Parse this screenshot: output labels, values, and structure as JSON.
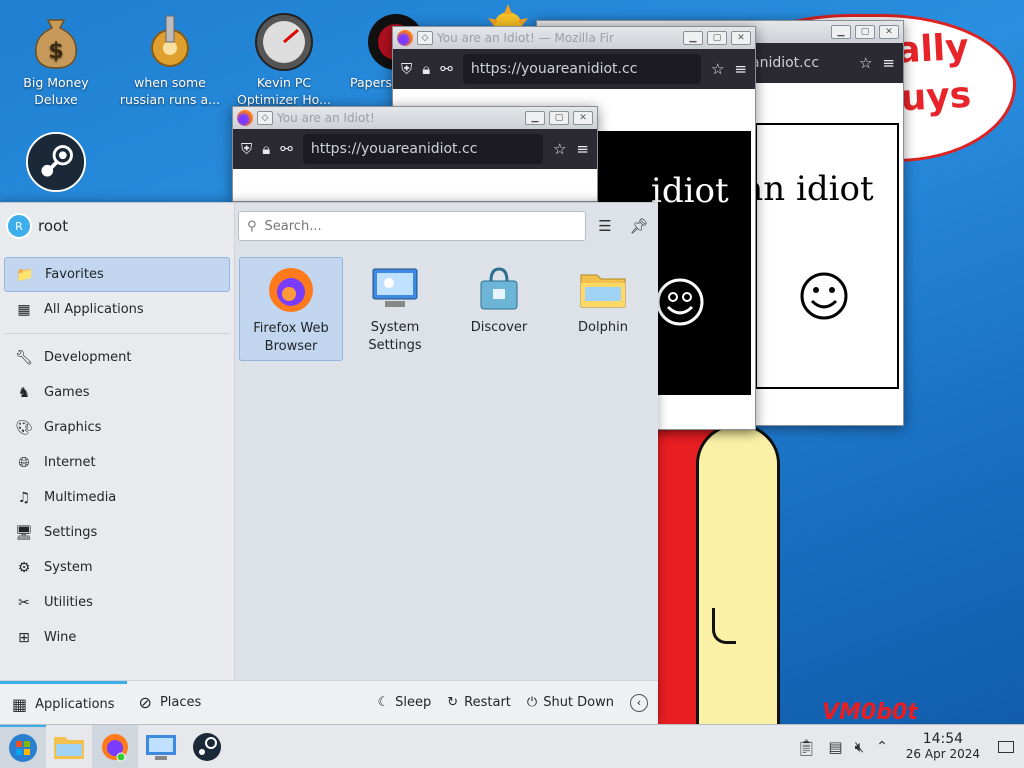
{
  "desktop": {
    "icons": [
      {
        "label": "Big Money\nDeluxe",
        "name": "big-money-deluxe"
      },
      {
        "label": "when some\nrussian runs a...",
        "name": "russian-runs"
      },
      {
        "label": "Kevin PC\nOptimizer Ho...",
        "name": "kevin-pc-optimizer"
      },
      {
        "label": "Papers",
        "name": "papers"
      }
    ],
    "background_text": "...is totally\nguys",
    "signature": "VM0b0t"
  },
  "windows": [
    {
      "title": "You are an Idiot! — Mozilla Fir",
      "url": "https://youareanidiot.cc",
      "content_text": "an idiot"
    },
    {
      "title": "",
      "url": "https://youareanidiot.cc",
      "content_text": "idiot"
    },
    {
      "title": "You are an Idiot!",
      "url": "https://youareanidiot.cc"
    }
  ],
  "menu": {
    "user": "root",
    "avatar_letter": "R",
    "search_placeholder": "Search...",
    "categories": [
      {
        "label": "Favorites",
        "active": true
      },
      {
        "label": "All Applications"
      },
      {
        "label": "Development"
      },
      {
        "label": "Games"
      },
      {
        "label": "Graphics"
      },
      {
        "label": "Internet"
      },
      {
        "label": "Multimedia"
      },
      {
        "label": "Settings"
      },
      {
        "label": "System"
      },
      {
        "label": "Utilities"
      },
      {
        "label": "Wine"
      }
    ],
    "apps": [
      {
        "label": "Firefox Web\nBrowser",
        "active": true
      },
      {
        "label": "System\nSettings"
      },
      {
        "label": "Discover"
      },
      {
        "label": "Dolphin"
      }
    ],
    "footer": {
      "applications": "Applications",
      "places": "Places",
      "sleep": "Sleep",
      "restart": "Restart",
      "shutdown": "Shut Down"
    }
  },
  "taskbar": {
    "time": "14:54",
    "date": "26 Apr 2024"
  },
  "colors": {
    "accent": "#3daee9",
    "selection": "#c2d6ef",
    "firefox_dark": "#2b2a33"
  }
}
